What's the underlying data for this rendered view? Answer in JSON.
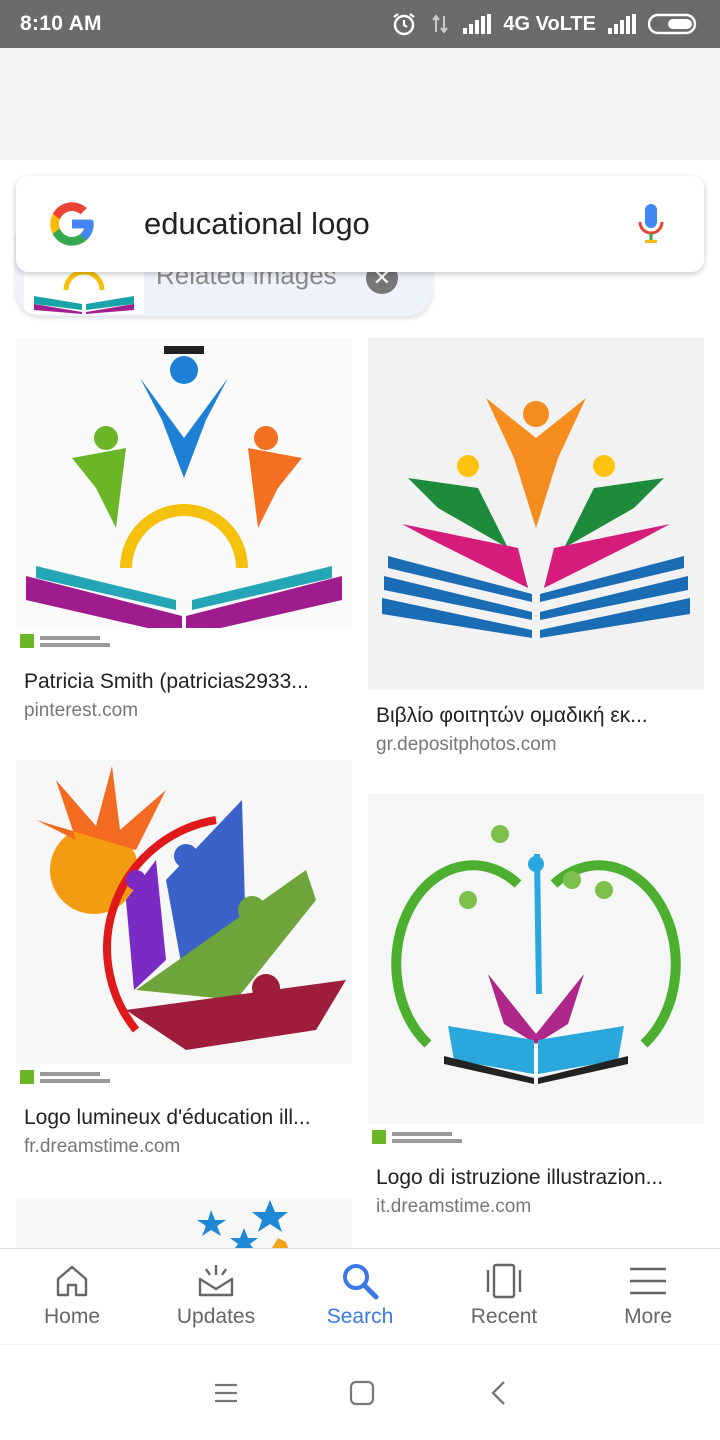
{
  "status_bar": {
    "time": "8:10 AM",
    "network": "4G VoLTE"
  },
  "search": {
    "query": "educational logo"
  },
  "related": {
    "label": "Related images"
  },
  "results": [
    {
      "title": "Patricia Smith (patricias2933...",
      "source": "pinterest.com"
    },
    {
      "title": "Βιβλίο φοιτητών ομαδική εκ...",
      "source": "gr.depositphotos.com"
    },
    {
      "title": "Logo lumineux d'éducation ill...",
      "source": "fr.dreamstime.com"
    },
    {
      "title": "Logo di istruzione illustrazion...",
      "source": "it.dreamstime.com"
    }
  ],
  "nav": {
    "home": "Home",
    "updates": "Updates",
    "search": "Search",
    "recent": "Recent",
    "more": "More"
  },
  "colors": {
    "accent": "#3b78e7",
    "status_bar": "#6b6b6b"
  }
}
